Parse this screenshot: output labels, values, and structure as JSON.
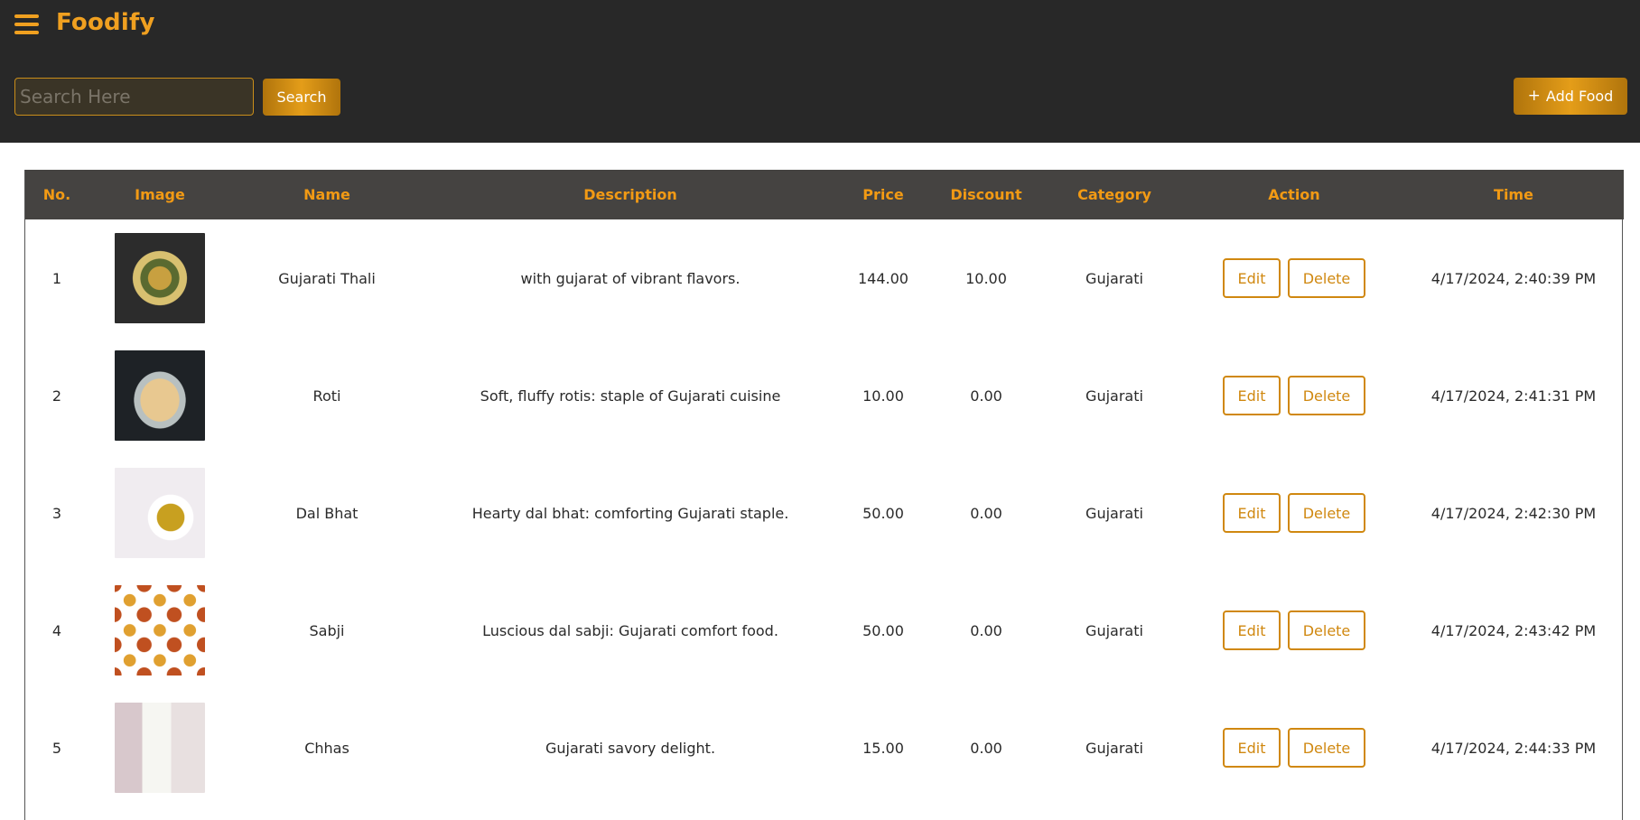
{
  "app": {
    "title": "Foodify"
  },
  "search": {
    "placeholder": "Search Here",
    "button": "Search"
  },
  "toolbar": {
    "add_label": "Add Food",
    "add_icon": "plus-icon"
  },
  "colors": {
    "accent": "#f0a020",
    "header_bg": "#282828",
    "table_head_bg": "#454341"
  },
  "table": {
    "columns": [
      "No.",
      "Image",
      "Name",
      "Description",
      "Price",
      "Discount",
      "Category",
      "Action",
      "Time"
    ],
    "rows": [
      {
        "no": "1",
        "image": "thali-photo",
        "name": "Gujarati Thali",
        "description": "with gujarat of vibrant flavors.",
        "price": "144.00",
        "discount": "10.00",
        "category": "Gujarati",
        "edit": "Edit",
        "delete": "Delete",
        "time": "4/17/2024, 2:40:39 PM"
      },
      {
        "no": "2",
        "image": "roti-photo",
        "name": "Roti",
        "description": "Soft, fluffy rotis: staple of Gujarati cuisine",
        "price": "10.00",
        "discount": "0.00",
        "category": "Gujarati",
        "edit": "Edit",
        "delete": "Delete",
        "time": "4/17/2024, 2:41:31 PM"
      },
      {
        "no": "3",
        "image": "dal-bhat-photo",
        "name": "Dal Bhat",
        "description": "Hearty dal bhat: comforting Gujarati staple.",
        "price": "50.00",
        "discount": "0.00",
        "category": "Gujarati",
        "edit": "Edit",
        "delete": "Delete",
        "time": "4/17/2024, 2:42:30 PM"
      },
      {
        "no": "4",
        "image": "sabji-photo",
        "name": "Sabji",
        "description": "Luscious dal sabji: Gujarati comfort food.",
        "price": "50.00",
        "discount": "0.00",
        "category": "Gujarati",
        "edit": "Edit",
        "delete": "Delete",
        "time": "4/17/2024, 2:43:42 PM"
      },
      {
        "no": "5",
        "image": "chhas-photo",
        "name": "Chhas",
        "description": "Gujarati savory delight.",
        "price": "15.00",
        "discount": "0.00",
        "category": "Gujarati",
        "edit": "Edit",
        "delete": "Delete",
        "time": "4/17/2024, 2:44:33 PM"
      }
    ]
  }
}
